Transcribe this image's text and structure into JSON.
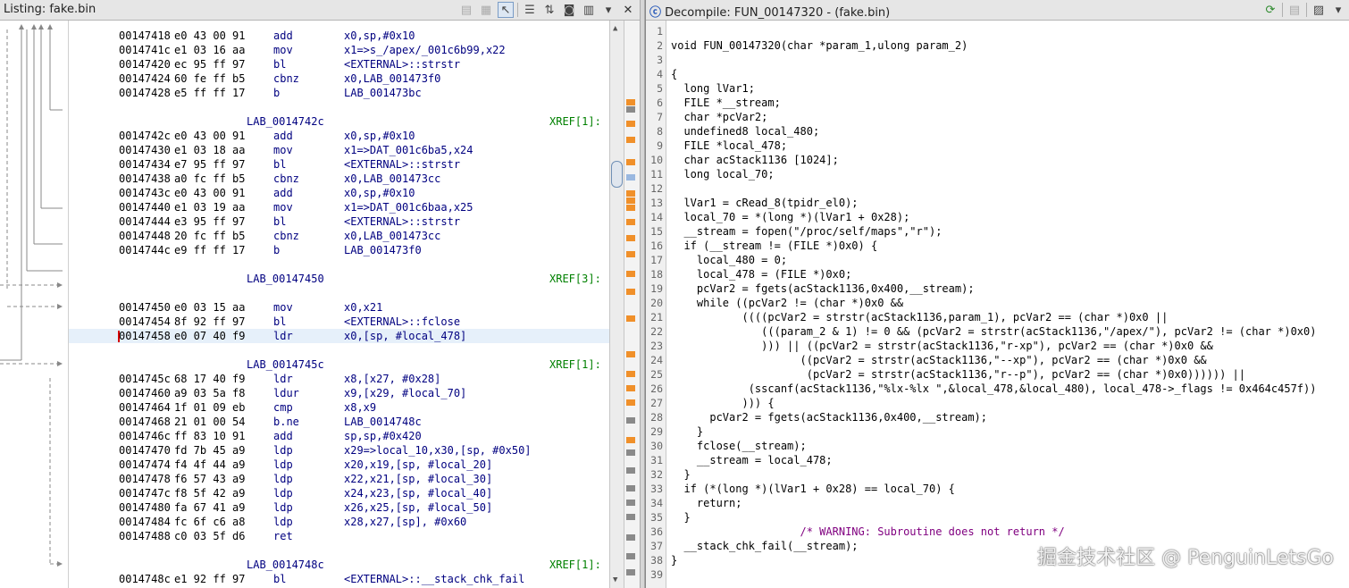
{
  "listing": {
    "title": "Listing:  fake.bin",
    "rows": [
      {
        "type": "code",
        "addr": "00147418",
        "bytes": "e0 43 00 91",
        "mnemonic": "add",
        "operands": "x0,sp,#0x10"
      },
      {
        "type": "code",
        "addr": "0014741c",
        "bytes": "e1 03 16 aa",
        "mnemonic": "mov",
        "operands": "x1=>s_/apex/_001c6b99,x22"
      },
      {
        "type": "code",
        "addr": "00147420",
        "bytes": "ec 95 ff 97",
        "mnemonic": "bl",
        "operands": "<EXTERNAL>::strstr"
      },
      {
        "type": "code",
        "addr": "00147424",
        "bytes": "60 fe ff b5",
        "mnemonic": "cbnz",
        "operands": "x0,LAB_001473f0"
      },
      {
        "type": "code",
        "addr": "00147428",
        "bytes": "e5 ff ff 17",
        "mnemonic": "b",
        "operands": "LAB_001473bc"
      },
      {
        "type": "blank"
      },
      {
        "type": "label",
        "label": "LAB_0014742c",
        "xref": "XREF[1]:"
      },
      {
        "type": "code",
        "addr": "0014742c",
        "bytes": "e0 43 00 91",
        "mnemonic": "add",
        "operands": "x0,sp,#0x10"
      },
      {
        "type": "code",
        "addr": "00147430",
        "bytes": "e1 03 18 aa",
        "mnemonic": "mov",
        "operands": "x1=>DAT_001c6ba5,x24"
      },
      {
        "type": "code",
        "addr": "00147434",
        "bytes": "e7 95 ff 97",
        "mnemonic": "bl",
        "operands": "<EXTERNAL>::strstr"
      },
      {
        "type": "code",
        "addr": "00147438",
        "bytes": "a0 fc ff b5",
        "mnemonic": "cbnz",
        "operands": "x0,LAB_001473cc"
      },
      {
        "type": "code",
        "addr": "0014743c",
        "bytes": "e0 43 00 91",
        "mnemonic": "add",
        "operands": "x0,sp,#0x10"
      },
      {
        "type": "code",
        "addr": "00147440",
        "bytes": "e1 03 19 aa",
        "mnemonic": "mov",
        "operands": "x1=>DAT_001c6baa,x25"
      },
      {
        "type": "code",
        "addr": "00147444",
        "bytes": "e3 95 ff 97",
        "mnemonic": "bl",
        "operands": "<EXTERNAL>::strstr"
      },
      {
        "type": "code",
        "addr": "00147448",
        "bytes": "20 fc ff b5",
        "mnemonic": "cbnz",
        "operands": "x0,LAB_001473cc"
      },
      {
        "type": "code",
        "addr": "0014744c",
        "bytes": "e9 ff ff 17",
        "mnemonic": "b",
        "operands": "LAB_001473f0"
      },
      {
        "type": "blank"
      },
      {
        "type": "label",
        "label": "LAB_00147450",
        "xref": "XREF[3]:"
      },
      {
        "type": "blank"
      },
      {
        "type": "code",
        "addr": "00147450",
        "bytes": "e0 03 15 aa",
        "mnemonic": "mov",
        "operands": "x0,x21"
      },
      {
        "type": "code",
        "addr": "00147454",
        "bytes": "8f 92 ff 97",
        "mnemonic": "bl",
        "operands": "<EXTERNAL>::fclose"
      },
      {
        "type": "code",
        "addr": "00147458",
        "bytes": "e0 07 40 f9",
        "mnemonic": "ldr",
        "operands": "x0,[sp, #local_478]",
        "highlight": true
      },
      {
        "type": "blank"
      },
      {
        "type": "label",
        "label": "LAB_0014745c",
        "xref": "XREF[1]:"
      },
      {
        "type": "code",
        "addr": "0014745c",
        "bytes": "68 17 40 f9",
        "mnemonic": "ldr",
        "operands": "x8,[x27, #0x28]"
      },
      {
        "type": "code",
        "addr": "00147460",
        "bytes": "a9 03 5a f8",
        "mnemonic": "ldur",
        "operands": "x9,[x29, #local_70]"
      },
      {
        "type": "code",
        "addr": "00147464",
        "bytes": "1f 01 09 eb",
        "mnemonic": "cmp",
        "operands": "x8,x9"
      },
      {
        "type": "code",
        "addr": "00147468",
        "bytes": "21 01 00 54",
        "mnemonic": "b.ne",
        "operands": "LAB_0014748c"
      },
      {
        "type": "code",
        "addr": "0014746c",
        "bytes": "ff 83 10 91",
        "mnemonic": "add",
        "operands": "sp,sp,#0x420"
      },
      {
        "type": "code",
        "addr": "00147470",
        "bytes": "fd 7b 45 a9",
        "mnemonic": "ldp",
        "operands": "x29=>local_10,x30,[sp, #0x50]"
      },
      {
        "type": "code",
        "addr": "00147474",
        "bytes": "f4 4f 44 a9",
        "mnemonic": "ldp",
        "operands": "x20,x19,[sp, #local_20]"
      },
      {
        "type": "code",
        "addr": "00147478",
        "bytes": "f6 57 43 a9",
        "mnemonic": "ldp",
        "operands": "x22,x21,[sp, #local_30]"
      },
      {
        "type": "code",
        "addr": "0014747c",
        "bytes": "f8 5f 42 a9",
        "mnemonic": "ldp",
        "operands": "x24,x23,[sp, #local_40]"
      },
      {
        "type": "code",
        "addr": "00147480",
        "bytes": "fa 67 41 a9",
        "mnemonic": "ldp",
        "operands": "x26,x25,[sp, #local_50]"
      },
      {
        "type": "code",
        "addr": "00147484",
        "bytes": "fc 6f c6 a8",
        "mnemonic": "ldp",
        "operands": "x28,x27,[sp], #0x60"
      },
      {
        "type": "code",
        "addr": "00147488",
        "bytes": "c0 03 5f d6",
        "mnemonic": "ret",
        "operands": ""
      },
      {
        "type": "blank"
      },
      {
        "type": "label",
        "label": "LAB_0014748c",
        "xref": "XREF[1]:"
      },
      {
        "type": "code",
        "addr": "0014748c",
        "bytes": "e1 92 ff 97",
        "mnemonic": "bl",
        "operands": "<EXTERNAL>::__stack_chk_fail"
      }
    ]
  },
  "decompile": {
    "title": "Decompile: FUN_00147320 -  (fake.bin)",
    "lines": [
      "",
      "void FUN_00147320(char *param_1,ulong param_2)",
      "",
      "{",
      "  long lVar1;",
      "  FILE *__stream;",
      "  char *pcVar2;",
      "  undefined8 local_480;",
      "  FILE *local_478;",
      "  char acStack1136 [1024];",
      "  long local_70;",
      "  ",
      "  lVar1 = cRead_8(tpidr_el0);",
      "  local_70 = *(long *)(lVar1 + 0x28);",
      "  __stream = fopen(\"/proc/self/maps\",\"r\");",
      "  if (__stream != (FILE *)0x0) {",
      "    local_480 = 0;",
      "    local_478 = (FILE *)0x0;",
      "    pcVar2 = fgets(acStack1136,0x400,__stream);",
      "    while ((pcVar2 != (char *)0x0 &&",
      "           ((((pcVar2 = strstr(acStack1136,param_1), pcVar2 == (char *)0x0 ||",
      "              (((param_2 & 1) != 0 && (pcVar2 = strstr(acStack1136,\"/apex/\"), pcVar2 != (char *)0x0)",
      "              ))) || ((pcVar2 = strstr(acStack1136,\"r-xp\"), pcVar2 == (char *)0x0 &&",
      "                    ((pcVar2 = strstr(acStack1136,\"--xp\"), pcVar2 == (char *)0x0 &&",
      "                     (pcVar2 = strstr(acStack1136,\"r--p\"), pcVar2 == (char *)0x0)))))) ||",
      "            (sscanf(acStack1136,\"%lx-%lx \",&local_478,&local_480), local_478->_flags != 0x464c457f))",
      "           ))) {",
      "      pcVar2 = fgets(acStack1136,0x400,__stream);",
      "    }",
      "    fclose(__stream);",
      "    __stream = local_478;",
      "  }",
      "  if (*(long *)(lVar1 + 0x28) == local_70) {",
      "    return;",
      "  }",
      "                    /* WARNING: Subroutine does not return */",
      "  __stack_chk_fail(__stream);",
      "}",
      ""
    ]
  },
  "watermark": "掘金技术社区 @ PenguinLetsGo",
  "icons": {
    "listing_toolbar": [
      "copy-icon",
      "paste-icon",
      "cursor-select-icon",
      "listing-fields-icon",
      "diff-icon",
      "snapshot-icon",
      "display-options-icon",
      "dropdown-icon",
      "close-icon"
    ],
    "decompile_toolbar": [
      "refresh-icon",
      "copy-icon",
      "export-icon",
      "more-icon"
    ]
  },
  "colors": {
    "address_link": "#000080",
    "register": "#808000",
    "xref": "#008000",
    "comment": "#800080",
    "marker": "#f0902a"
  }
}
